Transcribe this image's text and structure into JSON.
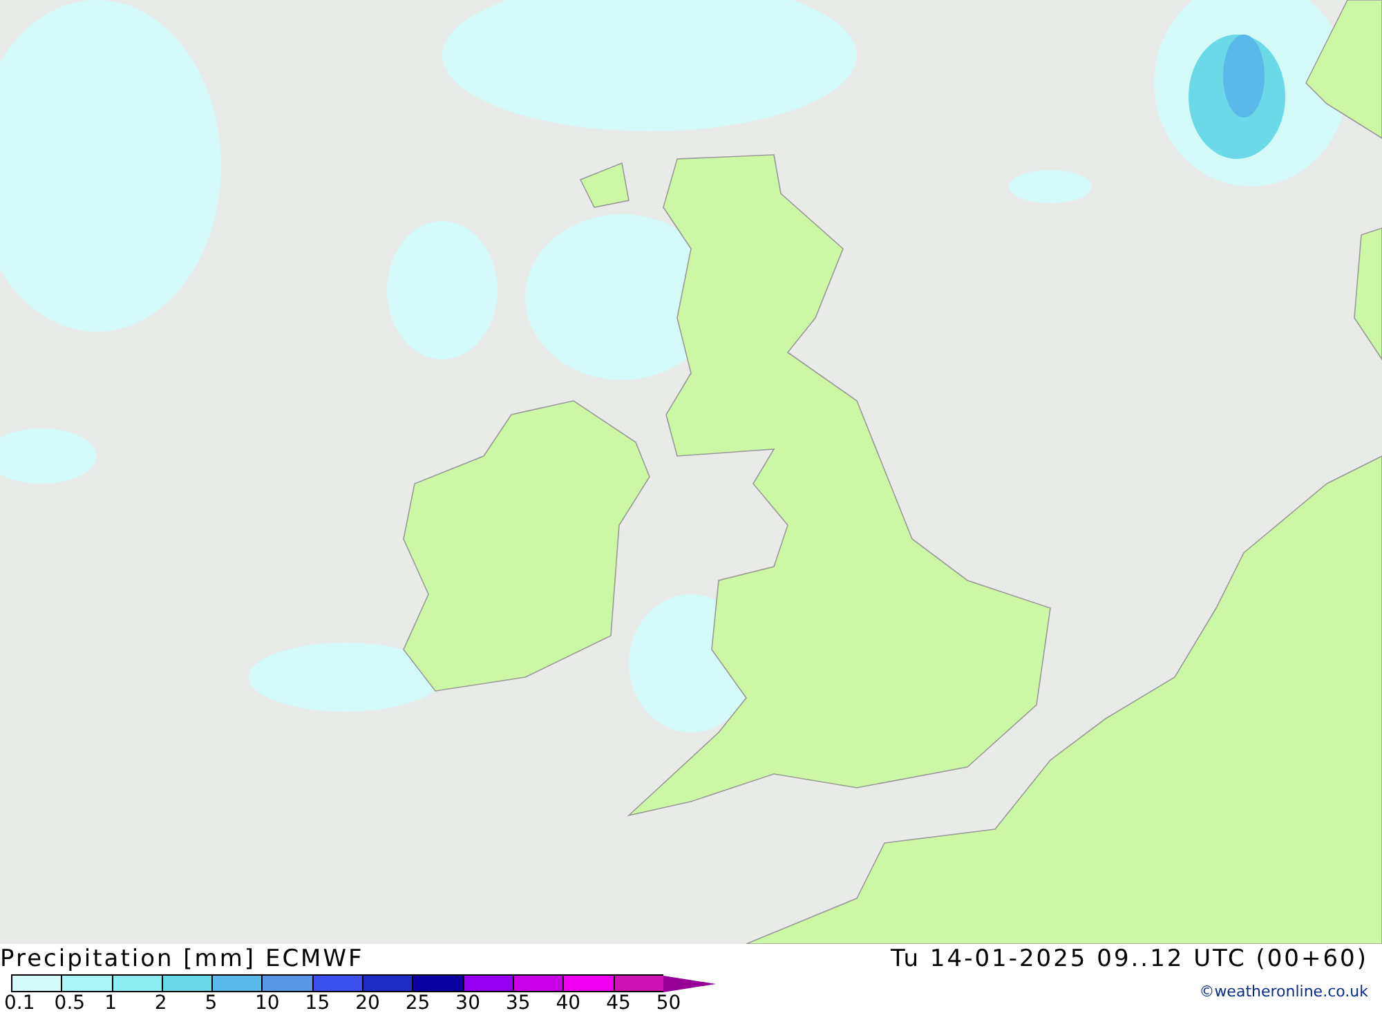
{
  "map": {
    "title": "Precipitation [mm]",
    "model": "ECMWF",
    "valid_time": "Tu 14-01-2025 09..12 UTC (00+60)",
    "credit": "©weatheronline.co.uk"
  },
  "legend": {
    "swatches": [
      {
        "color": "#d4fafa"
      },
      {
        "color": "#aaf5f5"
      },
      {
        "color": "#8ceef0"
      },
      {
        "color": "#6cd9e8"
      },
      {
        "color": "#5ab9e8"
      },
      {
        "color": "#5a96e6"
      },
      {
        "color": "#3c50f0"
      },
      {
        "color": "#1e2cc3"
      },
      {
        "color": "#0a00a0"
      },
      {
        "color": "#9600f0"
      },
      {
        "color": "#c800e6"
      },
      {
        "color": "#f000f0"
      },
      {
        "color": "#cc14b4"
      }
    ],
    "labels": [
      "0.1",
      "0.5",
      "1",
      "2",
      "5",
      "10",
      "15",
      "20",
      "25",
      "30",
      "35",
      "40",
      "45",
      "50"
    ]
  }
}
